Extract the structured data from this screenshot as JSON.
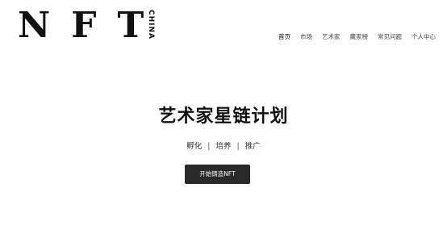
{
  "logo": {
    "letters": "NFT",
    "sub": "CHINA"
  },
  "nav": {
    "items": [
      {
        "label": "首页",
        "active": true
      },
      {
        "label": "市场",
        "active": false
      },
      {
        "label": "艺术家",
        "active": false
      },
      {
        "label": "藏家榜",
        "active": false
      },
      {
        "label": "常见问题",
        "active": false
      },
      {
        "label": "个人中心",
        "active": false
      }
    ]
  },
  "hero": {
    "title": "艺术家星链计划",
    "tags": [
      "孵化",
      "培养",
      "推广"
    ],
    "separator": "|",
    "cta_label": "开始铸造NFT"
  },
  "colors": {
    "background": "#ffffff",
    "text": "#111111",
    "button": "#2a2a2a",
    "button_text": "#ffffff"
  }
}
